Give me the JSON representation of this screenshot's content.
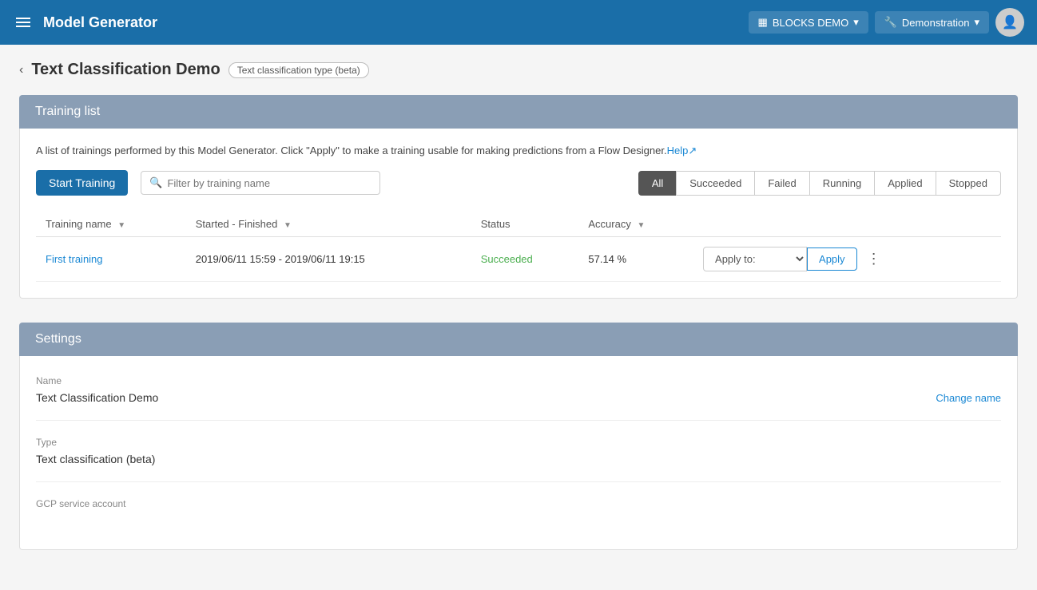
{
  "app": {
    "title": "Model Generator",
    "workspace": "BLOCKS DEMO",
    "user": "Demonstration"
  },
  "breadcrumb": {
    "page_title": "Text Classification Demo",
    "badge": "Text classification type (beta)"
  },
  "training_list": {
    "section_title": "Training list",
    "description": "A list of trainings performed by this Model Generator. Click \"Apply\" to make a training usable for making predictions from a Flow Designer.",
    "help_link": "Help",
    "start_button": "Start Training",
    "search_placeholder": "Filter by training name",
    "filters": [
      {
        "label": "All",
        "active": true
      },
      {
        "label": "Succeeded",
        "active": false
      },
      {
        "label": "Failed",
        "active": false
      },
      {
        "label": "Running",
        "active": false
      },
      {
        "label": "Applied",
        "active": false
      },
      {
        "label": "Stopped",
        "active": false
      }
    ],
    "columns": [
      {
        "label": "Training name"
      },
      {
        "label": "Started - Finished"
      },
      {
        "label": "Status"
      },
      {
        "label": "Accuracy"
      }
    ],
    "rows": [
      {
        "name": "First training",
        "started_finished": "2019/06/11 15:59 - 2019/06/11 19:15",
        "status": "Succeeded",
        "accuracy": "57.14 %",
        "apply_placeholder": "Apply to:",
        "apply_button": "Apply"
      }
    ]
  },
  "settings": {
    "section_title": "Settings",
    "name_label": "Name",
    "name_value": "Text Classification Demo",
    "change_name_link": "Change name",
    "type_label": "Type",
    "type_value": "Text classification (beta)",
    "gcp_label": "GCP service account"
  }
}
